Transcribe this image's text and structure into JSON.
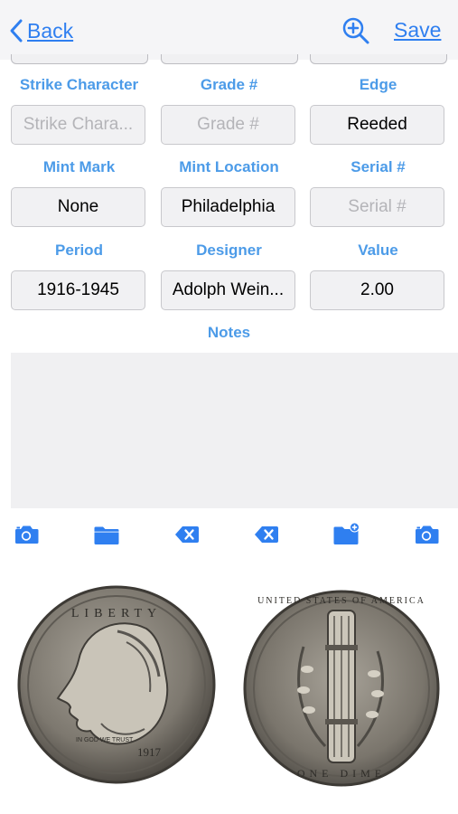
{
  "nav": {
    "back_label": "Back",
    "save_label": "Save",
    "zoom_icon": "zoom-in-icon"
  },
  "colors": {
    "accent": "#2f7ff0",
    "label": "#4c9be8",
    "field_bg": "#f1f1f3",
    "field_border": "#c8c8cc"
  },
  "fields": {
    "strike_character": {
      "label": "Strike Character",
      "value": "",
      "placeholder": "Strike Chara..."
    },
    "grade": {
      "label": "Grade #",
      "value": "",
      "placeholder": "Grade #"
    },
    "edge": {
      "label": "Edge",
      "value": "Reeded",
      "placeholder": ""
    },
    "mint_mark": {
      "label": "Mint Mark",
      "value": "None",
      "placeholder": ""
    },
    "mint_location": {
      "label": "Mint Location",
      "value": "Philadelphia",
      "placeholder": ""
    },
    "serial": {
      "label": "Serial #",
      "value": "",
      "placeholder": "Serial #"
    },
    "period": {
      "label": "Period",
      "value": "1916-1945",
      "placeholder": ""
    },
    "designer": {
      "label": "Designer",
      "value": "Adolph Wein...",
      "placeholder": ""
    },
    "value": {
      "label": "Value",
      "value": "2.00",
      "placeholder": ""
    }
  },
  "notes": {
    "label": "Notes",
    "value": ""
  },
  "toolbar": {
    "icons": [
      "camera-icon",
      "folder-icon",
      "delete-left-icon",
      "delete-x-icon",
      "folder-add-icon",
      "camera-icon"
    ]
  },
  "images": {
    "obverse": {
      "year_text": "1917",
      "motto_text": "IN GOD WE TRUST",
      "liberty_text": "LIBERTY"
    },
    "reverse": {
      "legend_text": "UNITED STATES OF AMERICA",
      "denomination_text": "ONE DIME"
    }
  }
}
